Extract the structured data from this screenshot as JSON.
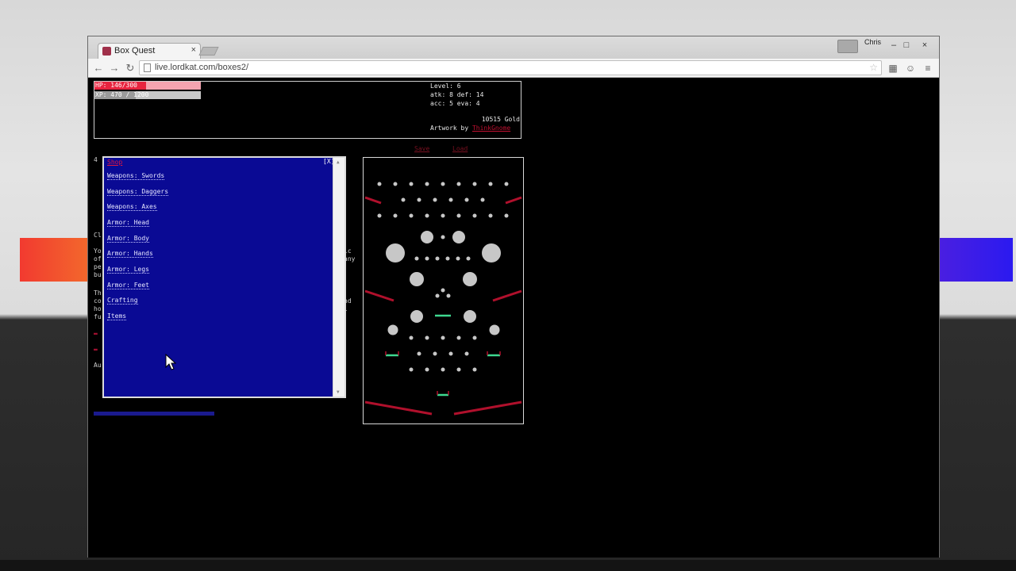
{
  "browser": {
    "tab_title": "Box Quest",
    "tab_close": "×",
    "user": "Chris",
    "url": "live.lordkat.com/boxes2/",
    "window_controls": [
      "–",
      "□",
      "×"
    ],
    "nav": {
      "back": "←",
      "forward": "→",
      "reload": "↻"
    },
    "star": "☆",
    "menu_icon": "≡"
  },
  "stats": {
    "hp_text": "HP: 146/300",
    "hp_fraction": 0.487,
    "xp_text": "XP: 470 / 1200",
    "xp_fraction": 0.39,
    "level": "Level: 6",
    "atk_def": "atk: 8 def: 14",
    "acc_eva": "acc: 5 eva: 4",
    "gold": "10515 Gold",
    "artwork_prefix": "Artwork by ",
    "artwork_link": "ThinkGnome"
  },
  "links": {
    "save": "Save",
    "load": "Load"
  },
  "menu": {
    "title": "Shop",
    "close": "[X]",
    "items": [
      "Weapons: Swords",
      "Weapons: Daggers",
      "Weapons: Axes",
      "Armor: Head",
      "Armor: Body",
      "Armor: Hands",
      "Armor: Legs",
      "Armor: Feet",
      "Crafting",
      "Items"
    ]
  },
  "background_text": {
    "lines": [
      "4",
      "Cl",
      "Yo",
      "of",
      "pe",
      "bu",
      "Th",
      "co",
      "ho",
      "fu",
      "Au"
    ],
    "right_lines": [
      "ic",
      "any",
      "nd",
      "l"
    ]
  },
  "colors": {
    "hp": "#e8243f",
    "panel": "#0a0a94",
    "bumper": "#c7c7c7",
    "flipper": "#b0102c",
    "target": "#3ed890"
  },
  "icons": {
    "cursor": "mouse-pointer-icon",
    "favicon": "box-quest-favicon-icon",
    "extensions": [
      "puzzle-extension-icon",
      "smiley-extension-icon"
    ]
  }
}
